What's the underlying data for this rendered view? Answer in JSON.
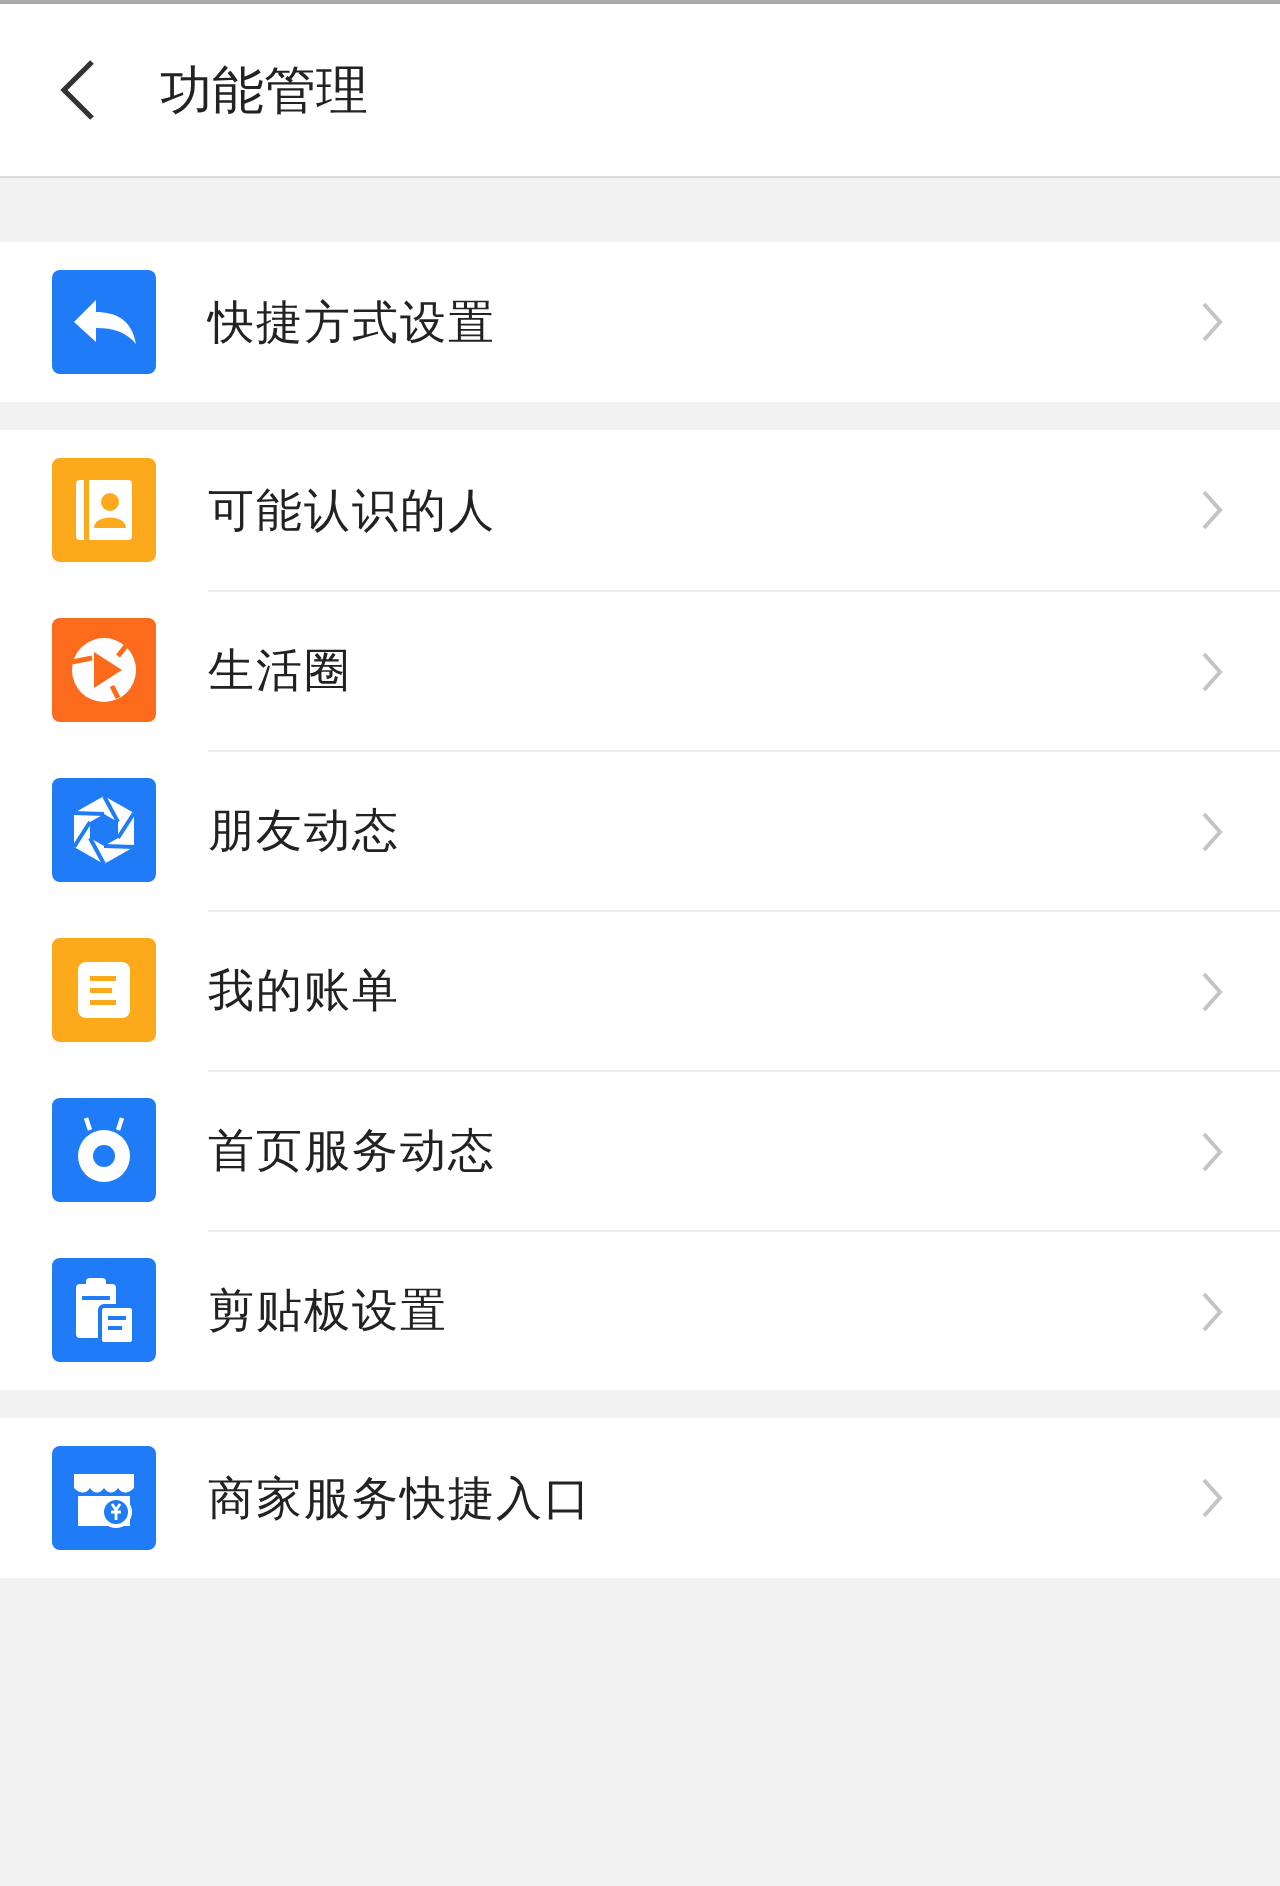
{
  "header": {
    "title": "功能管理"
  },
  "groups": [
    {
      "items": [
        {
          "label": "快捷方式设置",
          "kind": "reply",
          "color": "#1f7cf6"
        }
      ]
    },
    {
      "items": [
        {
          "label": "可能认识的人",
          "kind": "contacts",
          "color": "#fca91c"
        },
        {
          "label": "生活圈",
          "kind": "play",
          "color": "#fc6a1c"
        },
        {
          "label": "朋友动态",
          "kind": "shutter",
          "color": "#1f7cf6"
        },
        {
          "label": "我的账单",
          "kind": "bill",
          "color": "#fca91c"
        },
        {
          "label": "首页服务动态",
          "kind": "ring",
          "color": "#1f7cf6"
        },
        {
          "label": "剪贴板设置",
          "kind": "clipboard",
          "color": "#1f7cf6"
        }
      ]
    },
    {
      "items": [
        {
          "label": "商家服务快捷入口",
          "kind": "shop",
          "color": "#1f7cf6"
        }
      ]
    }
  ]
}
